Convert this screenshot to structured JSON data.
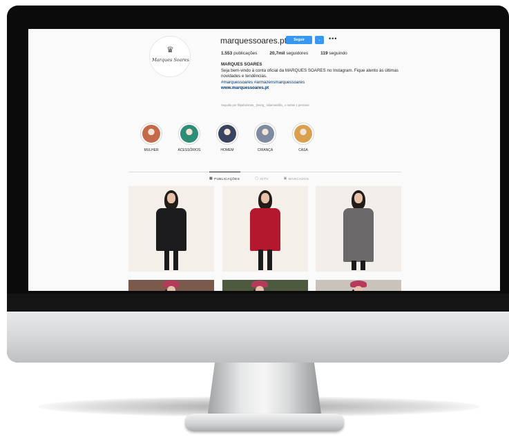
{
  "profile": {
    "username": "marquessoares.pt",
    "follow_label": "Seguir",
    "dropdown_label": "⌄",
    "more_label": "•••",
    "avatar_crest": "♛",
    "avatar_script": "Marques Soares",
    "posts_count": "1.553",
    "posts_label": "publicações",
    "followers_count": "20,7mil",
    "followers_label": "seguidores",
    "following_count": "119",
    "following_label": "seguindo",
    "bio_name": "MARQUES SOARES",
    "bio_text": "Seja bem-vindo à conta oficial da MARQUES SOARES no Instagram. Fique atento às últimas novidades e tendências.",
    "bio_tags": "#marquessoares #armazensmarquessoares",
    "bio_url": "www.marquessoares.pt",
    "followed_by": "Seguido por filipabonitato_ jtoung_ luliamasofila_ e outras 1 pessoas"
  },
  "highlights": [
    {
      "label": "MULHER",
      "color": "#c46a4a",
      "icon": "woman-photo-icon"
    },
    {
      "label": "ACESSÓRIOS",
      "color": "#2d8d77",
      "icon": "bag-photo-icon"
    },
    {
      "label": "HOMEM",
      "color": "#3a4460",
      "icon": "man-photo-icon"
    },
    {
      "label": "CRIANÇA",
      "color": "#7d8aa0",
      "icon": "kids-photo-icon"
    },
    {
      "label": "CASA",
      "color": "#d9a04f",
      "icon": "home-photo-icon"
    }
  ],
  "tabs": [
    {
      "label": "PUBLICAÇÕES",
      "icon": "▦",
      "active": true
    },
    {
      "label": "IGTV",
      "icon": "▢",
      "active": false
    },
    {
      "label": "MARCADOS",
      "icon": "▣",
      "active": false
    }
  ],
  "posts": [
    {
      "coat_color": "#1c1c1e",
      "bg": "#f4efe9",
      "caption_icon": "black-coat-photo"
    },
    {
      "coat_color": "#b3182f",
      "bg": "#f4efe9",
      "caption_icon": "red-jacket-photo"
    },
    {
      "coat_color": "#6a6868",
      "bg": "#f2eee9",
      "caption_icon": "grey-coat-photo"
    },
    {
      "coat_color": "#5b3f35",
      "bg": "#7a5a4c",
      "caption_icon": "woman-hat-photo"
    },
    {
      "coat_color": "#3e4a36",
      "bg": "#4d5a40",
      "caption_icon": "woman-hat-photo"
    },
    {
      "coat_color": "#8a8580",
      "bg": "#c9c3bc",
      "caption_icon": "woman-hat-photo"
    }
  ]
}
